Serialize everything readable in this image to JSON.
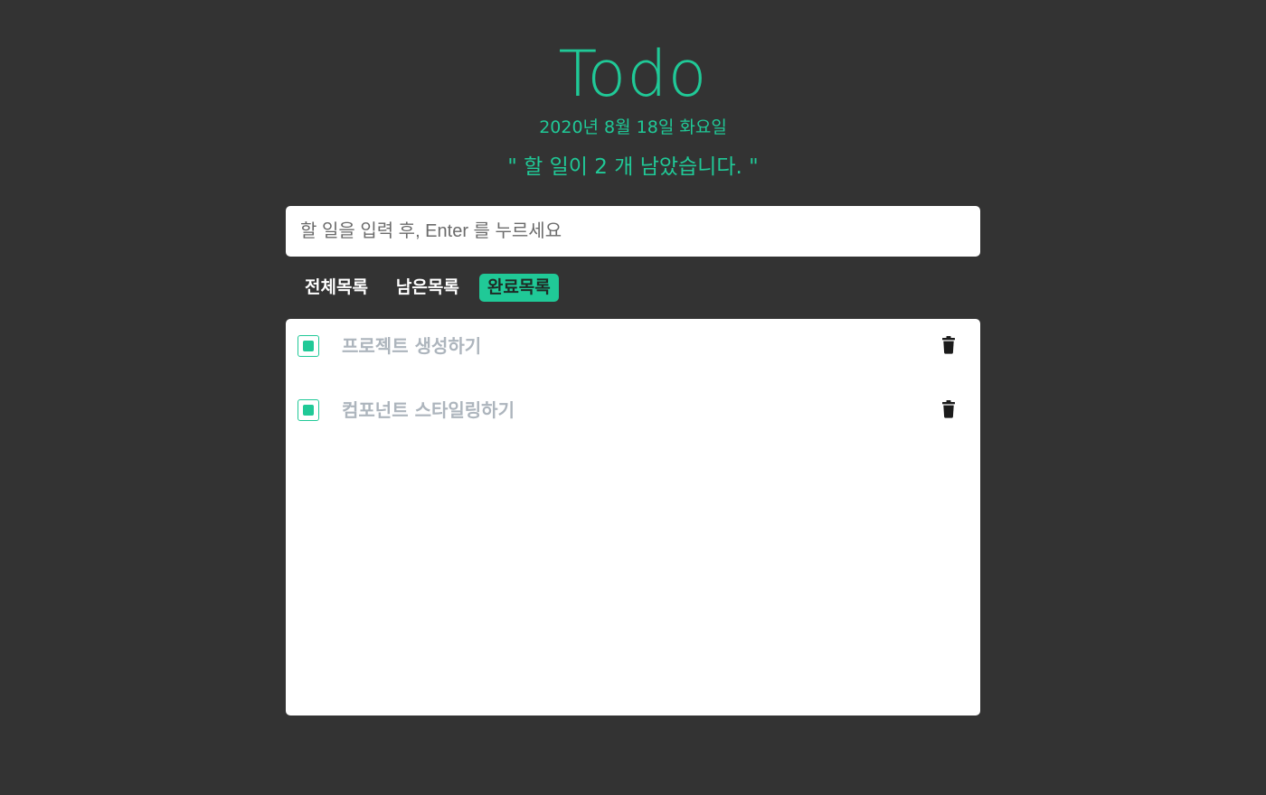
{
  "header": {
    "title": "Todo",
    "date": "2020년 8월 18일 화요일",
    "remaining": "\" 할 일이 2 개 남았습니다. \""
  },
  "input": {
    "placeholder": "할 일을 입력 후, Enter 를 누르세요",
    "value": ""
  },
  "filters": [
    {
      "label": "전체목록",
      "active": false
    },
    {
      "label": "남은목록",
      "active": false
    },
    {
      "label": "완료목록",
      "active": true
    }
  ],
  "todos": [
    {
      "text": "프로젝트 생성하기",
      "done": true
    },
    {
      "text": "컴포넌트 스타일링하기",
      "done": true
    }
  ],
  "icons": {
    "checkbox": "checkbox-checked-icon",
    "delete": "trash-icon"
  },
  "colors": {
    "accent": "#20c997",
    "background": "#333333",
    "done_text": "#adb5bd",
    "panel": "#ffffff"
  }
}
